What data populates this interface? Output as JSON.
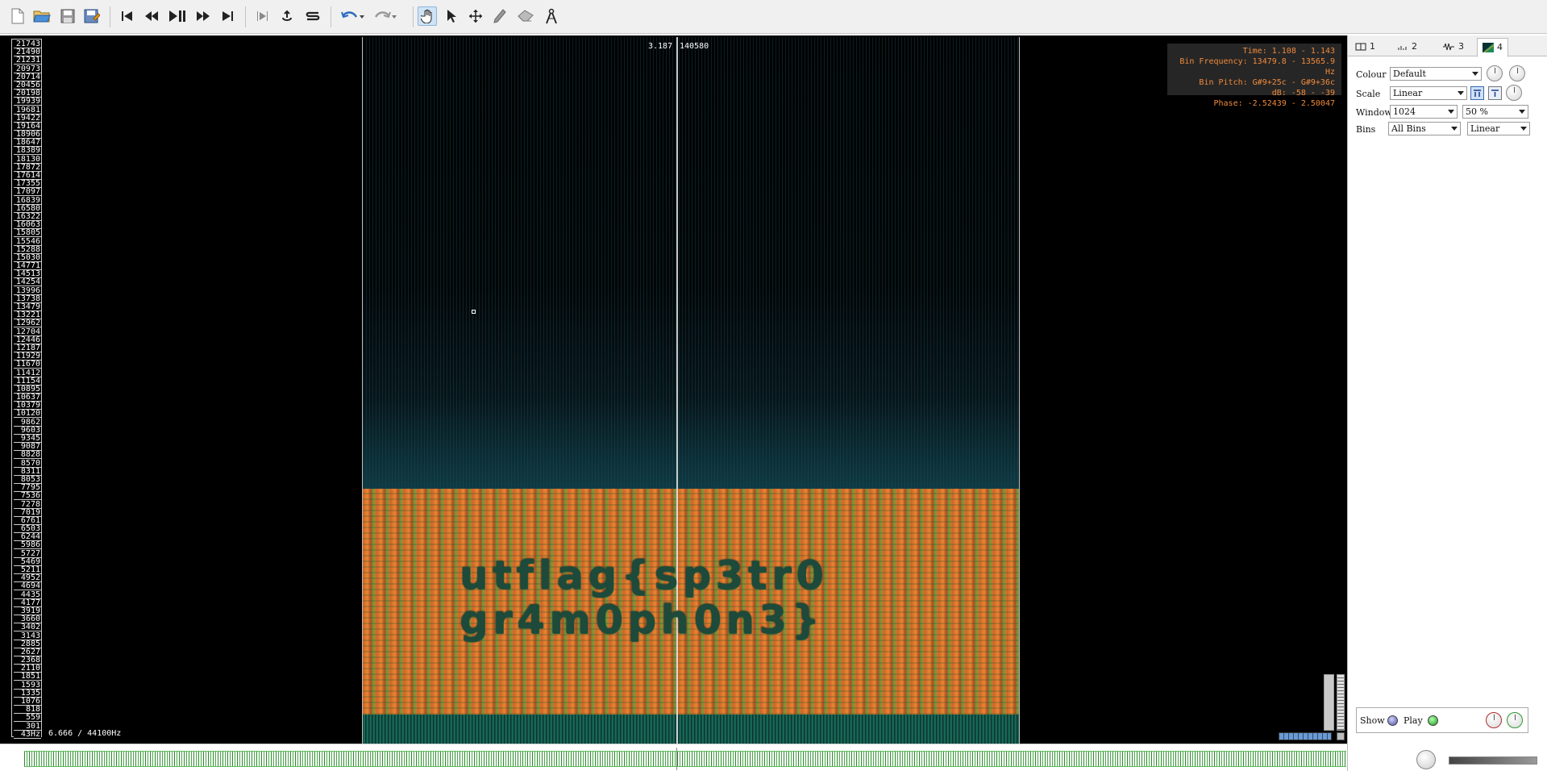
{
  "toolbar": {
    "icons": [
      "new-file-icon",
      "open-file-icon",
      "save-icon",
      "save-as-icon",
      "rewind-start-icon",
      "rewind-icon",
      "play-pause-icon",
      "fast-forward-icon",
      "fast-forward-end-icon",
      "play-selection-icon",
      "loop-icon",
      "solo-icon",
      "undo-icon",
      "redo-icon",
      "navigate-tool-icon",
      "select-tool-icon",
      "move-tool-icon",
      "draw-tool-icon",
      "erase-tool-icon",
      "measure-tool-icon"
    ]
  },
  "spectrogram": {
    "frequency_labels": [
      "21743",
      "21490",
      "21231",
      "20973",
      "20714",
      "20456",
      "20198",
      "19939",
      "19681",
      "19422",
      "19164",
      "18906",
      "18647",
      "18389",
      "18130",
      "17872",
      "17614",
      "17355",
      "17097",
      "16839",
      "16580",
      "16322",
      "16063",
      "15805",
      "15546",
      "15288",
      "15030",
      "14771",
      "14513",
      "14254",
      "13996",
      "13738",
      "13479",
      "13221",
      "12962",
      "12704",
      "12446",
      "12187",
      "11929",
      "11670",
      "11412",
      "11154",
      "10895",
      "10637",
      "10379",
      "10120",
      "9862",
      "9603",
      "9345",
      "9087",
      "8828",
      "8570",
      "8311",
      "8053",
      "7795",
      "7536",
      "7278",
      "7019",
      "6761",
      "6503",
      "6244",
      "5986",
      "5727",
      "5469",
      "5211",
      "4952",
      "4694",
      "4435",
      "4177",
      "3919",
      "3660",
      "3402",
      "3143",
      "2885",
      "2627",
      "2368",
      "2110",
      "1851",
      "1593",
      "1335",
      "1076",
      "818",
      "559",
      "301",
      "43Hz"
    ],
    "playhead_time": "3.187",
    "playhead_frame": "140580",
    "sample_rate_label": "6.666 / 44100Hz",
    "hidden_text": "utflag{sp3tr0\ngr4m0ph0n3}",
    "info": {
      "time": "Time: 1.108 - 1.143",
      "bin_frequency": "Bin Frequency: 13479.8 - 13565.9 Hz",
      "bin_pitch": "Bin Pitch: G#9+25c - G#9+36c",
      "db": "dB: -58 - -39",
      "phase": "Phase: -2.52439 - 2.50047"
    }
  },
  "panel": {
    "tabs": [
      {
        "label": "1",
        "icon": "layers-icon"
      },
      {
        "label": "2",
        "icon": "bars-icon"
      },
      {
        "label": "3",
        "icon": "waveform-icon"
      },
      {
        "label": "4",
        "icon": "spectrogram-icon"
      }
    ],
    "colour": {
      "label": "Colour",
      "value": "Default"
    },
    "scale": {
      "label": "Scale",
      "value": "Linear"
    },
    "window": {
      "label": "Window",
      "value": "1024",
      "overlap": "50 %"
    },
    "bins": {
      "label": "Bins",
      "value": "All Bins",
      "mode": "Linear"
    },
    "layer": {
      "show_label": "Show",
      "play_label": "Play"
    }
  }
}
